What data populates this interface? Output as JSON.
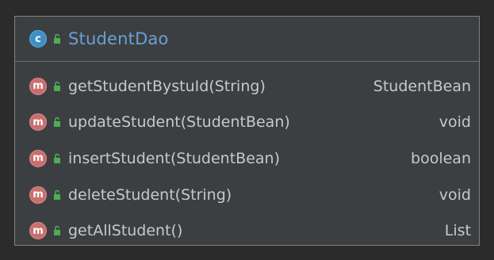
{
  "class": {
    "badge": "c",
    "name": "StudentDao",
    "icon": "class-icon",
    "visibility_icon": "public-lock-icon"
  },
  "methods": [
    {
      "badge": "m",
      "signature": "getStudentBystuId(String)",
      "return_type": "StudentBean"
    },
    {
      "badge": "m",
      "signature": "updateStudent(StudentBean)",
      "return_type": "void"
    },
    {
      "badge": "m",
      "signature": "insertStudent(StudentBean)",
      "return_type": "boolean"
    },
    {
      "badge": "m",
      "signature": "deleteStudent(String)",
      "return_type": "void"
    },
    {
      "badge": "m",
      "signature": "getAllStudent()",
      "return_type": "List"
    }
  ],
  "colors": {
    "background": "#2b2b2b",
    "box": "#3c3f41",
    "class_name": "#6a9fd4",
    "class_badge": "#3e8fc4",
    "method_badge": "#c86e6e",
    "lock": "#4caf50",
    "text": "#c8c8c8"
  }
}
